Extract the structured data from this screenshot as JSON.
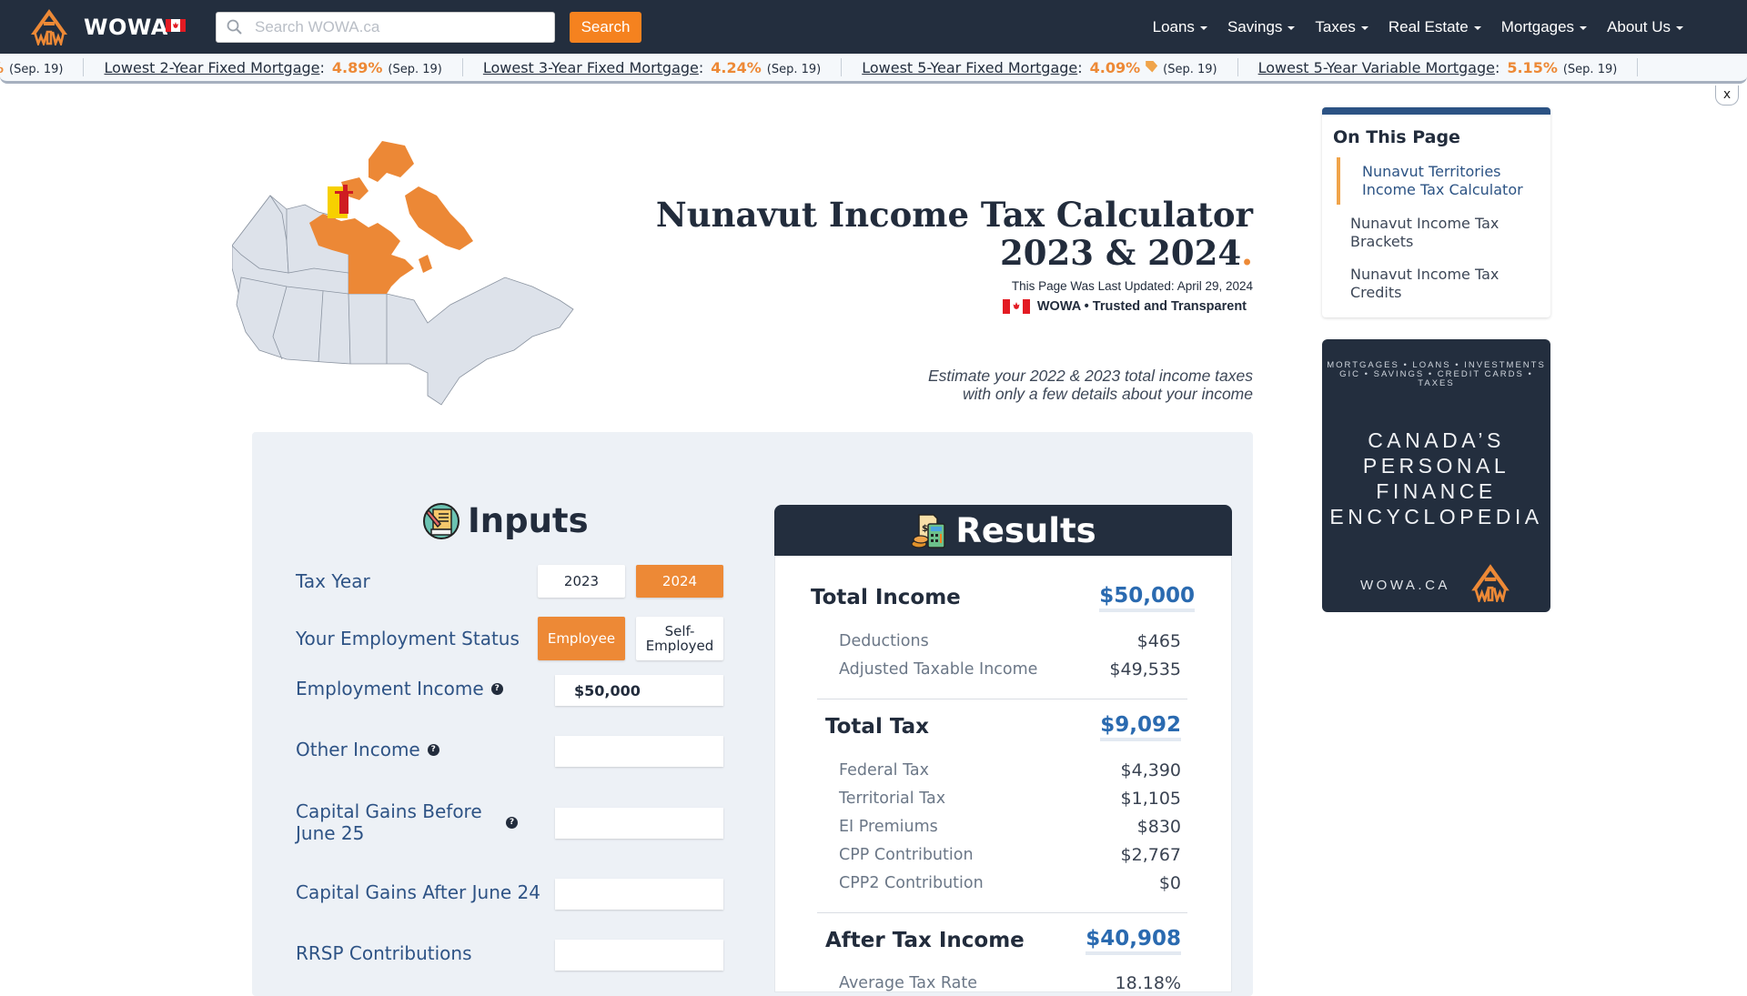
{
  "header": {
    "brand": "WOWA",
    "search_placeholder": "Search WOWA.ca",
    "search_value": "",
    "search_button": "Search",
    "nav": [
      {
        "label": "Loans"
      },
      {
        "label": "Savings"
      },
      {
        "label": "Taxes"
      },
      {
        "label": "Real Estate"
      },
      {
        "label": "Mortgages"
      },
      {
        "label": "About Us"
      }
    ]
  },
  "ticker": {
    "partial_leading": {
      "rate": "%",
      "date": "(Sep. 19)"
    },
    "items": [
      {
        "label": "Lowest 2-Year Fixed Mortgage",
        "rate": "4.89%",
        "date": "(Sep. 19)",
        "tag": false
      },
      {
        "label": "Lowest 3-Year Fixed Mortgage",
        "rate": "4.24%",
        "date": "(Sep. 19)",
        "tag": false
      },
      {
        "label": "Lowest 5-Year Fixed Mortgage",
        "rate": "4.09%",
        "date": "(Sep. 19)",
        "tag": true
      },
      {
        "label": "Lowest 5-Year Variable Mortgage",
        "rate": "5.15%",
        "date": "(Sep. 19)",
        "tag": false
      }
    ],
    "close_label": "x"
  },
  "hero": {
    "title_line1": "Nunavut Income Tax Calculator",
    "title_line2": "2023 & 2024",
    "title_dot": ".",
    "updated": "This Page Was Last Updated: April 29, 2024",
    "trust": "WOWA • Trusted and Transparent",
    "subtitle_line1": "Estimate your 2022 & 2023 total income taxes",
    "subtitle_line2": "with only a few details about your income"
  },
  "inputs": {
    "title": "Inputs",
    "tax_year": {
      "label": "Tax Year",
      "options": [
        "2023",
        "2024"
      ],
      "selected": "2024"
    },
    "employment_status": {
      "label": "Your Employment Status",
      "options": [
        "Employee",
        "Self-Employed"
      ],
      "selected": "Employee"
    },
    "fields": [
      {
        "label": "Employment Income",
        "value": "$50,000",
        "help": true
      },
      {
        "label": "Other Income",
        "value": "",
        "help": true
      },
      {
        "label": "Capital Gains Before June 25",
        "value": "",
        "help": true
      },
      {
        "label": "Capital Gains After June 24",
        "value": "",
        "help": false
      },
      {
        "label": "RRSP Contributions",
        "value": "",
        "help": false
      }
    ],
    "help_glyph": "?"
  },
  "results": {
    "title": "Results",
    "total_income": {
      "label": "Total Income",
      "value": "$50,000"
    },
    "income_details": [
      {
        "label": "Deductions",
        "value": "$465"
      },
      {
        "label": "Adjusted Taxable Income",
        "value": "$49,535"
      }
    ],
    "total_tax": {
      "label": "Total Tax",
      "value": "$9,092"
    },
    "tax_details": [
      {
        "label": "Federal Tax",
        "value": "$4,390"
      },
      {
        "label": "Territorial Tax",
        "value": "$1,105"
      },
      {
        "label": "EI Premiums",
        "value": "$830"
      },
      {
        "label": "CPP Contribution",
        "value": "$2,767"
      },
      {
        "label": "CPP2 Contribution",
        "value": "$0"
      }
    ],
    "after_tax": {
      "label": "After Tax Income",
      "value": "$40,908"
    },
    "average_tax_rate": {
      "label": "Average Tax Rate",
      "value": "18.18%"
    }
  },
  "toc": {
    "title": "On This Page",
    "items": [
      {
        "label": "Nunavut Territories Income Tax Calculator",
        "active": true
      },
      {
        "label": "Nunavut Income Tax Brackets",
        "active": false
      },
      {
        "label": "Nunavut Income Tax Credits",
        "active": false
      }
    ]
  },
  "ad": {
    "top_line1": "MORTGAGES • LOANS • INVESTMENTS",
    "top_line2": "GIC • SAVINGS • CREDIT CARDS • TAXES",
    "main_lines": [
      "CANADA’S",
      "PERSONAL",
      "FINANCE",
      "ENCYCLOPEDIA"
    ],
    "footer": "WOWA.CA"
  },
  "colors": {
    "header_bg": "#232e3e",
    "accent_orange": "#ed8936",
    "search_orange": "#f5821f",
    "link_blue": "#2a6ab0",
    "label_blue": "#2e5385",
    "panel_bg": "#edf1f6",
    "nunavut_orange": "#ec8836",
    "map_grey": "#dde2ea"
  }
}
